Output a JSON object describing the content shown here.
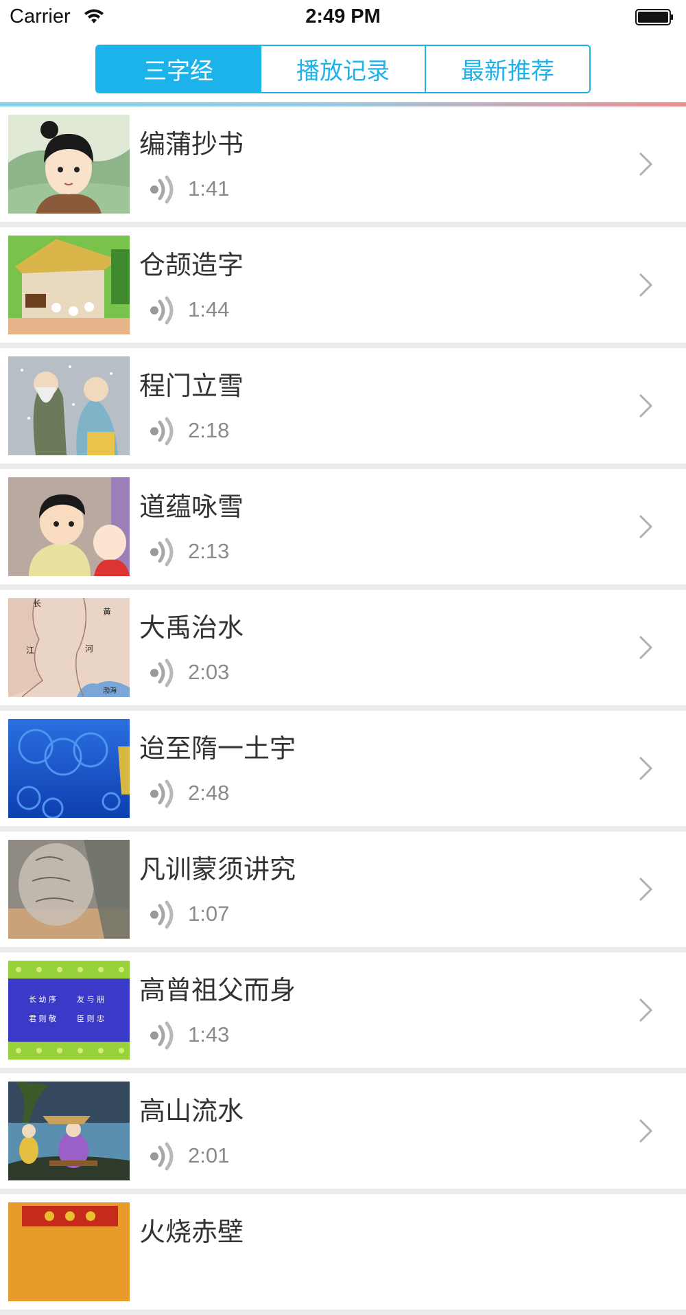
{
  "status_bar": {
    "carrier": "Carrier",
    "time": "2:49 PM"
  },
  "tabs": [
    {
      "label": "三字经",
      "active": true
    },
    {
      "label": "播放记录",
      "active": false
    },
    {
      "label": "最新推荐",
      "active": false
    }
  ],
  "colors": {
    "accent": "#1cb2ea",
    "row_separator": "#ececec",
    "duration_text": "#8a8a8a"
  },
  "items": [
    {
      "title": "编蒲抄书",
      "duration": "1:41"
    },
    {
      "title": "仓颉造字",
      "duration": "1:44"
    },
    {
      "title": "程门立雪",
      "duration": "2:18"
    },
    {
      "title": "道蕴咏雪",
      "duration": "2:13"
    },
    {
      "title": "大禹治水",
      "duration": "2:03",
      "thumb_labels": [
        "长",
        "黄",
        "江",
        "河",
        "渤海"
      ]
    },
    {
      "title": "迨至隋一土宇",
      "duration": "2:48"
    },
    {
      "title": "凡训蒙须讲究",
      "duration": "1:07"
    },
    {
      "title": "高曾祖父而身",
      "duration": "1:43",
      "thumb_labels": [
        "长 幼 序",
        "友 与 朋",
        "君 则 敬",
        "臣 则 忠"
      ]
    },
    {
      "title": "高山流水",
      "duration": "2:01"
    },
    {
      "title": "火烧赤壁",
      "duration": ""
    }
  ]
}
